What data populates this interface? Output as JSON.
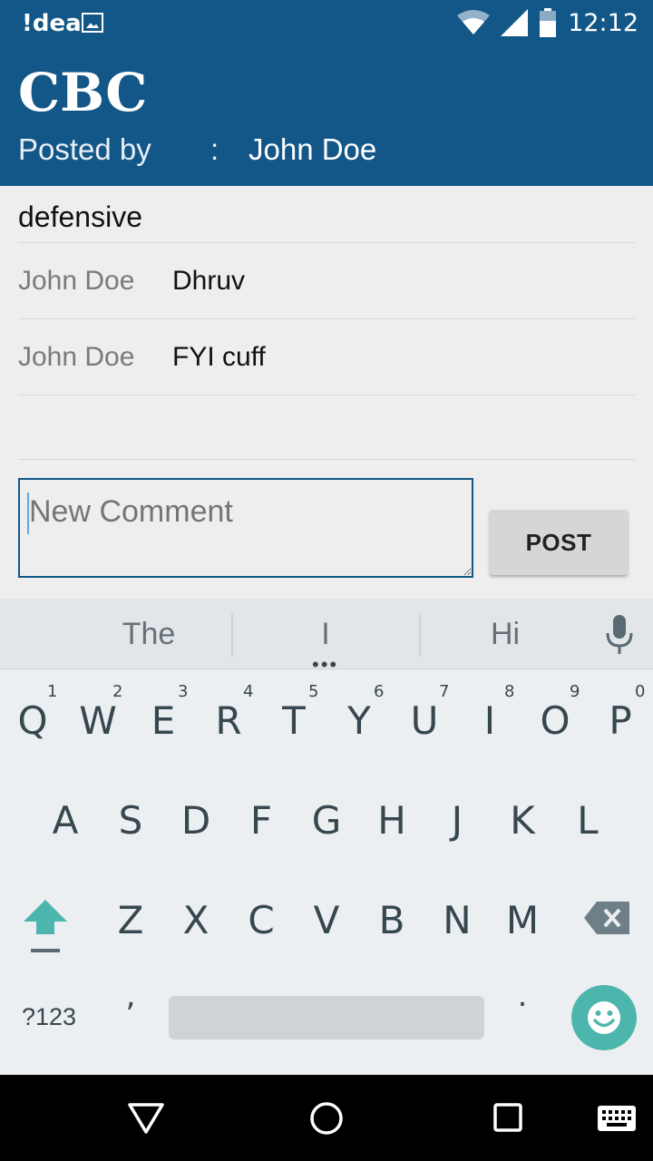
{
  "status_bar": {
    "carrier": "!dea",
    "time": "12:12"
  },
  "header": {
    "title": "CBC",
    "posted_by_label": "Posted by",
    "separator": ":",
    "author": "John Doe"
  },
  "post": {
    "body": "defensive"
  },
  "comments": [
    {
      "author": "John Doe",
      "text": "Dhruv"
    },
    {
      "author": "John Doe",
      "text": "FYI cuff"
    }
  ],
  "comment_input": {
    "value": "",
    "placeholder": "New Comment"
  },
  "post_button": {
    "label": "POST"
  },
  "keyboard": {
    "suggestions": [
      "The",
      "I",
      "Hi"
    ],
    "row1": [
      "Q",
      "W",
      "E",
      "R",
      "T",
      "Y",
      "U",
      "I",
      "O",
      "P"
    ],
    "row1_hints": [
      "1",
      "2",
      "3",
      "4",
      "5",
      "6",
      "7",
      "8",
      "9",
      "0"
    ],
    "row2": [
      "A",
      "S",
      "D",
      "F",
      "G",
      "H",
      "J",
      "K",
      "L"
    ],
    "row3": [
      "Z",
      "X",
      "C",
      "V",
      "B",
      "N",
      "M"
    ],
    "symbols_key": "?123",
    "comma_key": ",",
    "period_key": ".",
    "colors": {
      "accent": "#4db6ac",
      "key_text": "#37474f"
    }
  },
  "colors": {
    "app_bar": "#135788",
    "background": "#eeeeee"
  }
}
